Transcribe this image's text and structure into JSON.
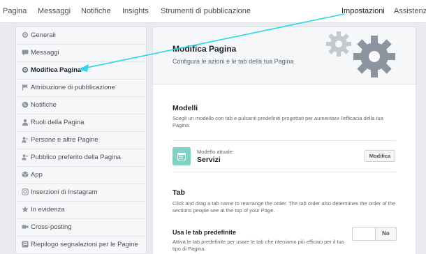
{
  "topnav": {
    "tabs": [
      {
        "label": "Pagina"
      },
      {
        "label": "Messaggi"
      },
      {
        "label": "Notifiche"
      },
      {
        "label": "Insights"
      },
      {
        "label": "Strumenti di pubblicazione"
      },
      {
        "label": "Impostazioni"
      },
      {
        "label": "Assistenza"
      }
    ]
  },
  "sidebar": {
    "items": [
      {
        "label": "Generali",
        "icon": "gear-icon"
      },
      {
        "label": "Messaggi",
        "icon": "chat-icon"
      },
      {
        "label": "Modifica Pagina",
        "icon": "gear-icon",
        "active": true
      },
      {
        "label": "Attribuzione di pubblicazione",
        "icon": "flag-icon"
      },
      {
        "label": "Notifiche",
        "icon": "globe-icon"
      },
      {
        "label": "Ruoli della Pagina",
        "icon": "person-icon"
      },
      {
        "label": "Persone e altre Pagine",
        "icon": "people-icon"
      },
      {
        "label": "Pubblico preferito della Pagina",
        "icon": "people-icon"
      },
      {
        "label": "App",
        "icon": "cube-icon"
      },
      {
        "label": "Inserzioni di Instagram",
        "icon": "instagram-icon"
      },
      {
        "label": "In evidenza",
        "icon": "star-icon"
      },
      {
        "label": "Cross-posting",
        "icon": "video-icon"
      },
      {
        "label": "Riepilogo segnalazioni per le Pagine",
        "icon": "flag-box-icon"
      }
    ]
  },
  "main": {
    "title": "Modifica Pagina",
    "subtitle": "Configura le azioni e le tab della tua Pagina",
    "templates": {
      "heading": "Modelli",
      "description_line1": "Scegli un modello con tab e pulsanti predefiniti progettati per aumentare l'efficacia della tua",
      "description_line2": "Pagina.",
      "current_label": "Modello attuale:",
      "current_name": "Servizi",
      "edit_button": "Modifica"
    },
    "tabs": {
      "heading": "Tab",
      "description_line1": "Click and drag a tab name to rearrange the order. The tab order also determines the order of the",
      "description_line2": "sections people see at the top of your Page.",
      "default_tabs_label": "Usa le tab predefinite",
      "default_tabs_desc_line1": "Attiva le tab predefinite per usare le tab che riteniamo più efficaci per il tuo",
      "default_tabs_desc_line2": "tipo di Pagina.",
      "toggle_value": "No"
    }
  },
  "colors": {
    "annotation_arrow": "#2fd6e6",
    "template_icon_bg": "#7fd1c4",
    "gear": "#9aa3ad"
  }
}
